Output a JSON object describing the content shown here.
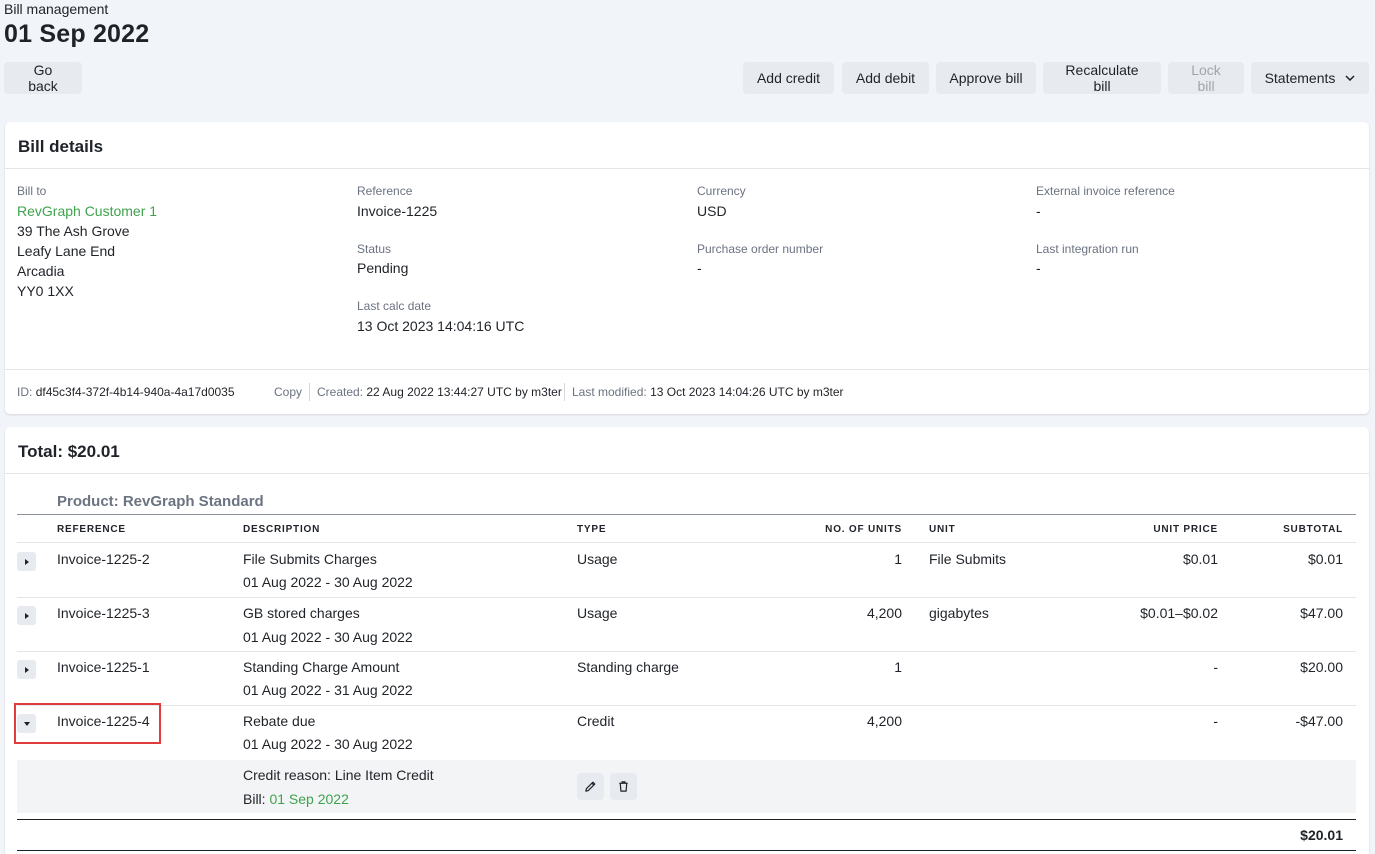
{
  "header": {
    "subtitle": "Bill management",
    "title": "01 Sep 2022"
  },
  "toolbar": {
    "go_back": "Go back",
    "add_credit": "Add credit",
    "add_debit": "Add debit",
    "approve_bill": "Approve bill",
    "recalculate_bill": "Recalculate bill",
    "lock_bill": "Lock bill",
    "statements": "Statements"
  },
  "bill_details": {
    "title": "Bill details",
    "bill_to_label": "Bill to",
    "customer": "RevGraph Customer 1",
    "address": [
      "39 The Ash Grove",
      "Leafy Lane End",
      "Arcadia",
      "YY0 1XX"
    ],
    "reference_label": "Reference",
    "reference": "Invoice-1225",
    "status_label": "Status",
    "status": "Pending",
    "last_calc_label": "Last calc date",
    "last_calc": "13 Oct 2023 14:04:16 UTC",
    "currency_label": "Currency",
    "currency": "USD",
    "po_label": "Purchase order number",
    "po": "-",
    "ext_ref_label": "External invoice reference",
    "ext_ref": "-",
    "last_integration_label": "Last integration run",
    "last_integration": "-",
    "meta": {
      "id_label": "ID:",
      "id": "df45c3f4-372f-4b14-940a-4a17d0035",
      "copy": "Copy",
      "created_label": "Created:",
      "created": "22 Aug 2022 13:44:27 UTC by m3ter",
      "modified_label": "Last modified:",
      "modified": "13 Oct 2023 14:04:26 UTC by m3ter"
    }
  },
  "total": {
    "title": "Total: $20.01",
    "product": "Product: RevGraph Standard",
    "columns": {
      "reference": "REFERENCE",
      "description": "DESCRIPTION",
      "type": "TYPE",
      "units": "NO. OF UNITS",
      "unit": "UNIT",
      "unit_price": "UNIT PRICE",
      "subtotal": "SUBTOTAL"
    },
    "rows": [
      {
        "reference": "Invoice-1225-2",
        "description": "File Submits Charges",
        "period": "01 Aug 2022 - 30 Aug 2022",
        "type": "Usage",
        "units": "1",
        "unit": "File Submits",
        "unit_price": "$0.01",
        "subtotal": "$0.01"
      },
      {
        "reference": "Invoice-1225-3",
        "description": "GB stored charges",
        "period": "01 Aug 2022 - 30 Aug 2022",
        "type": "Usage",
        "units": "4,200",
        "unit": "gigabytes",
        "unit_price": "$0.01–$0.02",
        "subtotal": "$47.00"
      },
      {
        "reference": "Invoice-1225-1",
        "description": "Standing Charge Amount",
        "period": "01 Aug 2022 - 31 Aug 2022",
        "type": "Standing charge",
        "units": "1",
        "unit": "",
        "unit_price": "-",
        "subtotal": "$20.00"
      },
      {
        "reference": "Invoice-1225-4",
        "description": "Rebate due",
        "period": "01 Aug 2022 - 30 Aug 2022",
        "type": "Credit",
        "units": "4,200",
        "unit": "",
        "unit_price": "-",
        "subtotal": "-$47.00"
      }
    ],
    "detail": {
      "credit_reason": "Credit reason: Line Item Credit",
      "bill_label": "Bill:",
      "bill_link": "01 Sep 2022"
    },
    "grand_total": "$20.01"
  },
  "colors": {
    "link": "#3fa34d",
    "highlight": "#e03c3c"
  },
  "icons": [
    "chevron-down-icon",
    "caret-right-icon",
    "caret-down-icon",
    "pencil-icon",
    "trash-icon"
  ]
}
